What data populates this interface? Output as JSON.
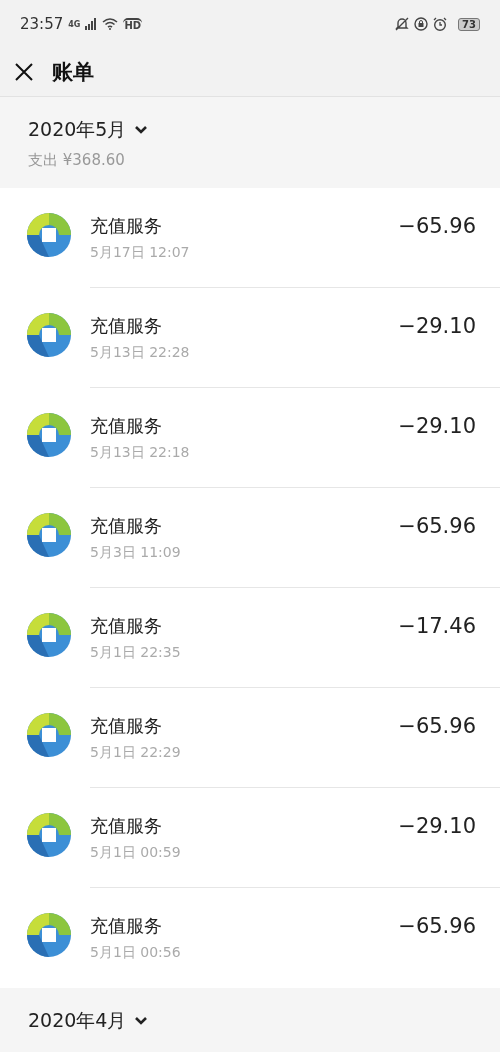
{
  "status_bar": {
    "time": "23:57",
    "network": "4G",
    "hd": "HD",
    "battery": "73"
  },
  "header": {
    "title": "账单"
  },
  "months": [
    {
      "label": "2020年5月",
      "summary": "支出 ¥368.60",
      "transactions": [
        {
          "title": "充值服务",
          "time": "5月17日 12:07",
          "amount": "−65.96"
        },
        {
          "title": "充值服务",
          "time": "5月13日 22:28",
          "amount": "−29.10"
        },
        {
          "title": "充值服务",
          "time": "5月13日 22:18",
          "amount": "−29.10"
        },
        {
          "title": "充值服务",
          "time": "5月3日 11:09",
          "amount": "−65.96"
        },
        {
          "title": "充值服务",
          "time": "5月1日 22:35",
          "amount": "−17.46"
        },
        {
          "title": "充值服务",
          "time": "5月1日 22:29",
          "amount": "−65.96"
        },
        {
          "title": "充值服务",
          "time": "5月1日 00:59",
          "amount": "−29.10"
        },
        {
          "title": "充值服务",
          "time": "5月1日 00:56",
          "amount": "−65.96"
        }
      ]
    },
    {
      "label": "2020年4月"
    }
  ]
}
